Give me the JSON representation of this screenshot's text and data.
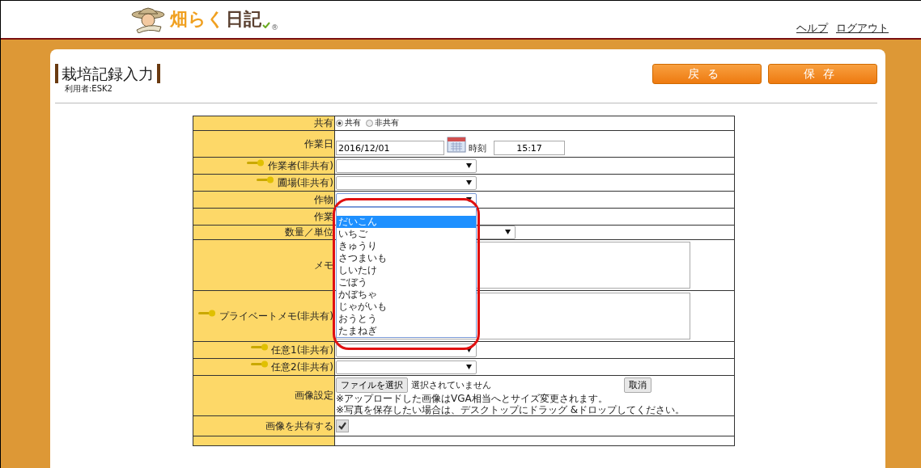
{
  "header": {
    "logo_parts": [
      {
        "text": "畑らく",
        "color": "#f0a020"
      },
      {
        "text": "日記",
        "color": "#5a4030"
      }
    ],
    "logo_mark": "®",
    "links": [
      "ヘルプ",
      "ログアウト"
    ]
  },
  "page": {
    "title": "栽培記録入力",
    "user": "利用者:ESK2",
    "buttons": [
      "戻る",
      "保存"
    ]
  },
  "form": {
    "rows": [
      {
        "label": "共有",
        "kind": "radio",
        "private": false,
        "options": [
          {
            "label": "共有",
            "selected": true
          },
          {
            "label": "非共有",
            "selected": false
          }
        ]
      },
      {
        "label": "作業日",
        "kind": "date",
        "private": false,
        "value": "2016/12/01",
        "time_label": "時刻",
        "time": "15:17"
      },
      {
        "label": "作業者(非共有)",
        "kind": "select",
        "private": true
      },
      {
        "label": "圃場(非共有)",
        "kind": "select",
        "private": true
      },
      {
        "label": "作物",
        "kind": "select",
        "private": false,
        "open": true
      },
      {
        "label": "作業",
        "kind": "select",
        "private": false
      },
      {
        "label": "数量／単位",
        "kind": "quantity",
        "private": false
      },
      {
        "label": "メモ",
        "kind": "textarea",
        "private": false
      },
      {
        "label": "プライベートメモ(非共有)",
        "kind": "textarea",
        "private": true
      },
      {
        "label": "任意1(非共有)",
        "kind": "select",
        "private": true
      },
      {
        "label": "任意2(非共有)",
        "kind": "select",
        "private": true
      },
      {
        "label": "画像設定",
        "kind": "file",
        "private": false,
        "button": "ファイルを選択",
        "status": "選択されていません",
        "cancel": "取消",
        "notes": [
          "※アップロードした画像はVGA相当へとサイズ変更されます。",
          "※写真を保存したい場合は、デスクトップにドラッグ &ドロップしてください。"
        ]
      },
      {
        "label": "画像を共有する",
        "kind": "checkbox",
        "private": false,
        "checked": true
      },
      {
        "label": "",
        "kind": "empty",
        "private": false
      }
    ]
  },
  "dropdown": {
    "options": [
      {
        "label": "だいこん",
        "selected": true
      },
      {
        "label": "いちご",
        "selected": false
      },
      {
        "label": "きゅうり",
        "selected": false
      },
      {
        "label": "さつまいも",
        "selected": false
      },
      {
        "label": "しいたけ",
        "selected": false
      },
      {
        "label": "ごぼう",
        "selected": false
      },
      {
        "label": "かぼちゃ",
        "selected": false
      },
      {
        "label": "じゃがいも",
        "selected": false
      },
      {
        "label": "おうとう",
        "selected": false
      },
      {
        "label": "たまねぎ",
        "selected": false
      }
    ]
  }
}
